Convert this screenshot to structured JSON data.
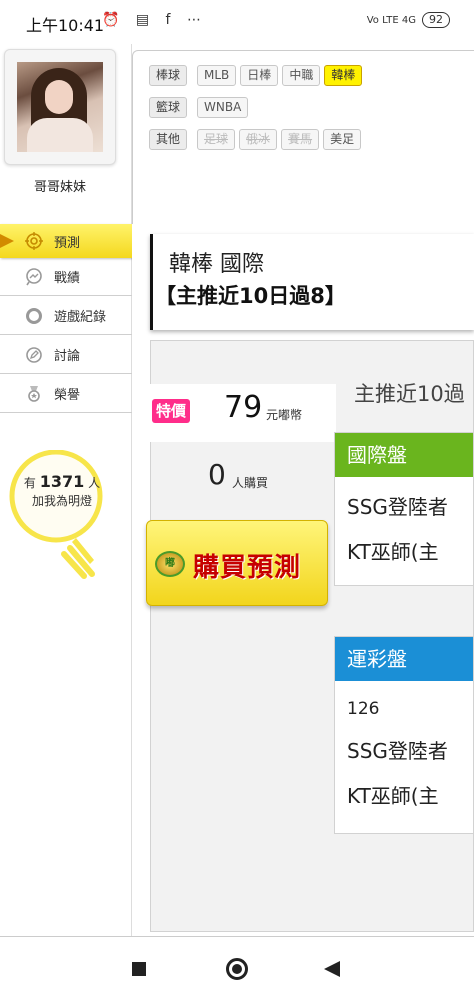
{
  "statusbar": {
    "time": "上午10:41",
    "icons": "⏰ ▤ f ⋯",
    "network": "Vo LTE 4G",
    "battery": "92"
  },
  "sidebar": {
    "nickname": "哥哥妹妹",
    "menu": [
      {
        "label": "預測",
        "icon": "target-icon",
        "active": true
      },
      {
        "label": "戰績",
        "icon": "chart-bubble-icon",
        "active": false
      },
      {
        "label": "遊戲紀錄",
        "icon": "ring-icon",
        "active": false
      },
      {
        "label": "討論",
        "icon": "pencil-circle-icon",
        "active": false
      },
      {
        "label": "榮譽",
        "icon": "medal-icon",
        "active": false
      }
    ],
    "bulb": {
      "prefix": "有",
      "count": "1371",
      "suffix": "人",
      "line2": "加我為明燈"
    }
  },
  "filters": {
    "baseball": {
      "category": "棒球",
      "items": [
        "MLB",
        "日棒",
        "中職",
        "韓棒"
      ],
      "active": "韓棒"
    },
    "basketball": {
      "category": "籃球",
      "items": [
        "WNBA"
      ]
    },
    "other": {
      "category": "其他",
      "items": [
        "足球",
        "俄冰",
        "賽馬",
        "美足"
      ],
      "disabled": [
        "足球",
        "俄冰",
        "賽馬"
      ]
    }
  },
  "title_card": {
    "line1": "韓棒 國際",
    "line2": "【主推近10日過8】"
  },
  "offer": {
    "badge": "特價",
    "price": "79",
    "unit": "元嘟幣",
    "buyers_count": "0",
    "buyers_label": "人購買",
    "buy_button": "購買預測"
  },
  "preview": {
    "title": "主推近10過"
  },
  "cards": {
    "intl": {
      "header": "國際盤",
      "header_color": "#6ab51e",
      "rows": [
        "SSG登陸者",
        "KT巫師(主"
      ]
    },
    "lottery": {
      "header": "運彩盤",
      "header_color": "#1b8fd6",
      "rows": [
        "126",
        "SSG登陸者",
        "KT巫師(主"
      ]
    }
  }
}
